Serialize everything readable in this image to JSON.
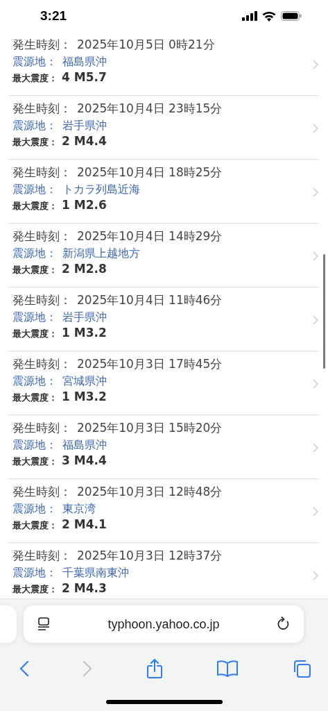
{
  "status_bar": {
    "time": "3:21"
  },
  "quakes": [
    {
      "time_label": "発生時刻：",
      "time": "2025年10月5日 0時21分",
      "place_label": "震源地：",
      "place": "福島県沖",
      "intensity_label": "最大震度：",
      "intensity": "4",
      "magnitude": "M5.7"
    },
    {
      "time_label": "発生時刻：",
      "time": "2025年10月4日 23時15分",
      "place_label": "震源地：",
      "place": "岩手県沖",
      "intensity_label": "最大震度：",
      "intensity": "2",
      "magnitude": "M4.4"
    },
    {
      "time_label": "発生時刻：",
      "time": "2025年10月4日 18時25分",
      "place_label": "震源地：",
      "place": "トカラ列島近海",
      "intensity_label": "最大震度：",
      "intensity": "1",
      "magnitude": "M2.6"
    },
    {
      "time_label": "発生時刻：",
      "time": "2025年10月4日 14時29分",
      "place_label": "震源地：",
      "place": "新潟県上越地方",
      "intensity_label": "最大震度：",
      "intensity": "2",
      "magnitude": "M2.8"
    },
    {
      "time_label": "発生時刻：",
      "time": "2025年10月4日 11時46分",
      "place_label": "震源地：",
      "place": "岩手県沖",
      "intensity_label": "最大震度：",
      "intensity": "1",
      "magnitude": "M3.2"
    },
    {
      "time_label": "発生時刻：",
      "time": "2025年10月3日 17時45分",
      "place_label": "震源地：",
      "place": "宮城県沖",
      "intensity_label": "最大震度：",
      "intensity": "1",
      "magnitude": "M3.2"
    },
    {
      "time_label": "発生時刻：",
      "time": "2025年10月3日 15時20分",
      "place_label": "震源地：",
      "place": "福島県沖",
      "intensity_label": "最大震度：",
      "intensity": "3",
      "magnitude": "M4.4"
    },
    {
      "time_label": "発生時刻：",
      "time": "2025年10月3日 12時48分",
      "place_label": "震源地：",
      "place": "東京湾",
      "intensity_label": "最大震度：",
      "intensity": "2",
      "magnitude": "M4.1"
    },
    {
      "time_label": "発生時刻：",
      "time": "2025年10月3日 12時37分",
      "place_label": "震源地：",
      "place": "千葉県南東沖",
      "intensity_label": "最大震度：",
      "intensity": "2",
      "magnitude": "M4.3"
    }
  ],
  "address_bar": {
    "url": "typhoon.yahoo.co.jp"
  },
  "toolbar": [
    {
      "kind": "back",
      "disabled": false
    },
    {
      "kind": "forward",
      "disabled": true
    },
    {
      "kind": "share",
      "disabled": false
    },
    {
      "kind": "bookmarks",
      "disabled": false
    },
    {
      "kind": "tabs",
      "disabled": false
    }
  ]
}
